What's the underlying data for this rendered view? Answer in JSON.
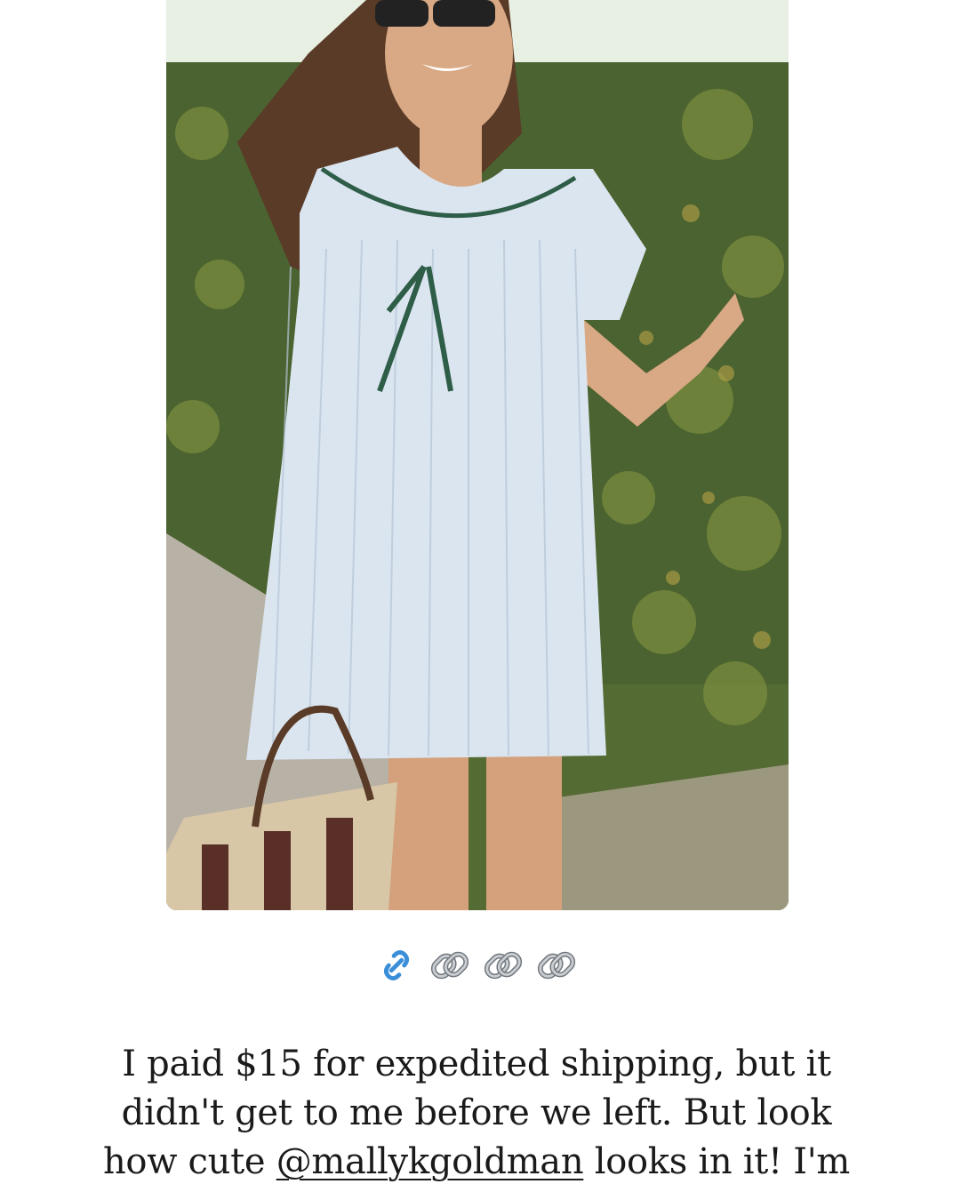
{
  "post": {
    "photo_icon": "photo-image",
    "link_icons": [
      "link-icon",
      "chain-link-icon",
      "chain-link-icon",
      "chain-link-icon"
    ],
    "caption_before": "I paid $15 for expedited shipping, but it didn't get to me before we left. But look how cute ",
    "mention": "@mallykgoldman",
    "caption_after": " looks in it! I'm"
  },
  "colors": {
    "link_blue": "#3b8fd9",
    "chain_gray": "#9aa0a6",
    "text": "#1a1a1a"
  }
}
